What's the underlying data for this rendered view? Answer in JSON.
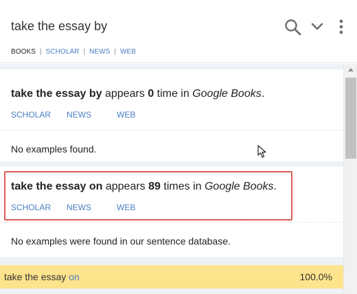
{
  "header": {
    "query": "take the essay by",
    "sources": {
      "selected": "BOOKS",
      "links": [
        "SCHOLAR",
        "NEWS",
        "WEB"
      ],
      "separator": "|"
    },
    "icons": [
      "search-icon",
      "chevron-down-icon",
      "more-vert-icon"
    ]
  },
  "results": [
    {
      "phrase": "take the essay by",
      "pre": "appears",
      "count": "0",
      "post": "time in",
      "source": "Google Books",
      "end": ".",
      "links": [
        "SCHOLAR",
        "NEWS",
        "WEB"
      ],
      "message": "No examples found."
    },
    {
      "phrase": "take the essay on",
      "pre": "appears",
      "count": "89",
      "post": "times in",
      "source": "Google Books",
      "end": ".",
      "links": [
        "SCHOLAR",
        "NEWS",
        "WEB"
      ],
      "message": "No examples were found in our sentence database."
    }
  ],
  "summary": {
    "phrase_base": "take the essay",
    "phrase_word": "on",
    "percent": "100.0%"
  },
  "colors": {
    "link": "#4a7fc2",
    "highlight_row": "#fde38c",
    "annotation_box": "#e05a5a",
    "content_bg": "#eef2f6"
  }
}
